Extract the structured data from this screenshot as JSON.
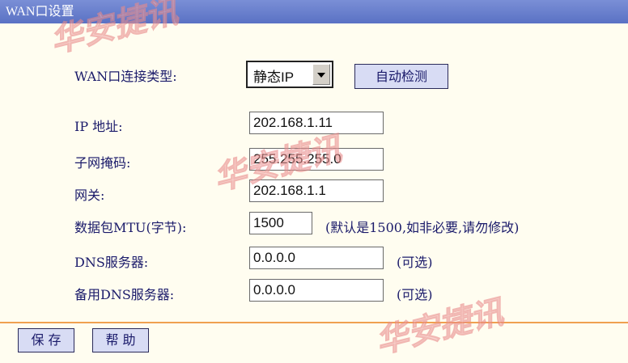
{
  "title": "WAN口设置",
  "connection_type": {
    "label": "WAN口连接类型:",
    "selected": "静态IP",
    "detect_button": "自动检测"
  },
  "fields": {
    "ip": {
      "label": "IP 地址:",
      "value": "202.168.1.11"
    },
    "mask": {
      "label": "子网掩码:",
      "value": "255.255.255.0"
    },
    "gateway": {
      "label": "网关:",
      "value": "202.168.1.1"
    },
    "mtu": {
      "label": "数据包MTU(字节):",
      "value": "1500",
      "note": "(默认是1500,如非必要,请勿修改)"
    },
    "dns": {
      "label": "DNS服务器:",
      "value": "0.0.0.0",
      "note": "(可选)"
    },
    "dns2": {
      "label": "备用DNS服务器:",
      "value": "0.0.0.0",
      "note": "(可选)"
    }
  },
  "buttons": {
    "save": "保 存",
    "help": "帮 助"
  },
  "watermark": "华安捷讯",
  "colors": {
    "titlebar": "#5a72c4",
    "background": "#fffdf0",
    "divider": "#f0a050",
    "button": "#d8dcf4"
  }
}
